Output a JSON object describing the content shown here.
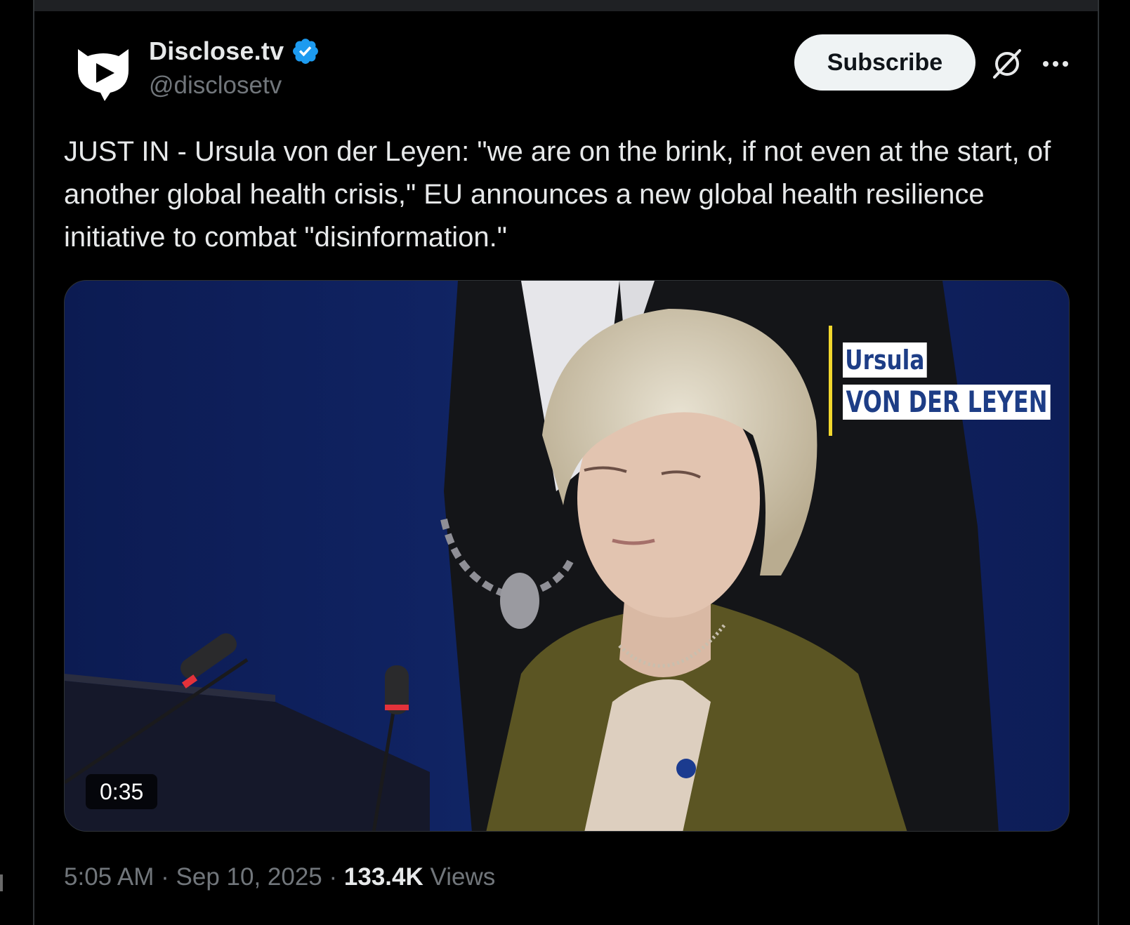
{
  "post": {
    "author": {
      "display_name": "Disclose.tv",
      "handle": "@disclosetv",
      "verified": true,
      "verified_color": "#1d9bf0",
      "avatar_icon": "disclose-logo-icon"
    },
    "actions": {
      "subscribe_label": "Subscribe",
      "grok_icon": "grok-icon",
      "more_icon": "more-options-icon"
    },
    "text": "JUST IN - Ursula von der Leyen: \"we are on the brink, if not even at the start, of another global health crisis,\" EU announces a new global health resilience initiative to combat \"disinformation.\"",
    "media": {
      "type": "video",
      "duration": "0:35",
      "caption_first_name": "Ursula",
      "caption_last_name": "VON DER LEYEN"
    },
    "meta": {
      "time": "5:05 AM",
      "separator": " · ",
      "date": "Sep 10, 2025",
      "views_count": "133.4K",
      "views_label": " Views"
    }
  },
  "colors": {
    "background": "#000000",
    "text_primary": "#e7e9ea",
    "text_secondary": "#71767b",
    "button_bg": "#eff3f4",
    "video_backdrop": "#0e1f58",
    "caption_bar": "#f2d72d",
    "caption_text": "#1d3d86"
  }
}
